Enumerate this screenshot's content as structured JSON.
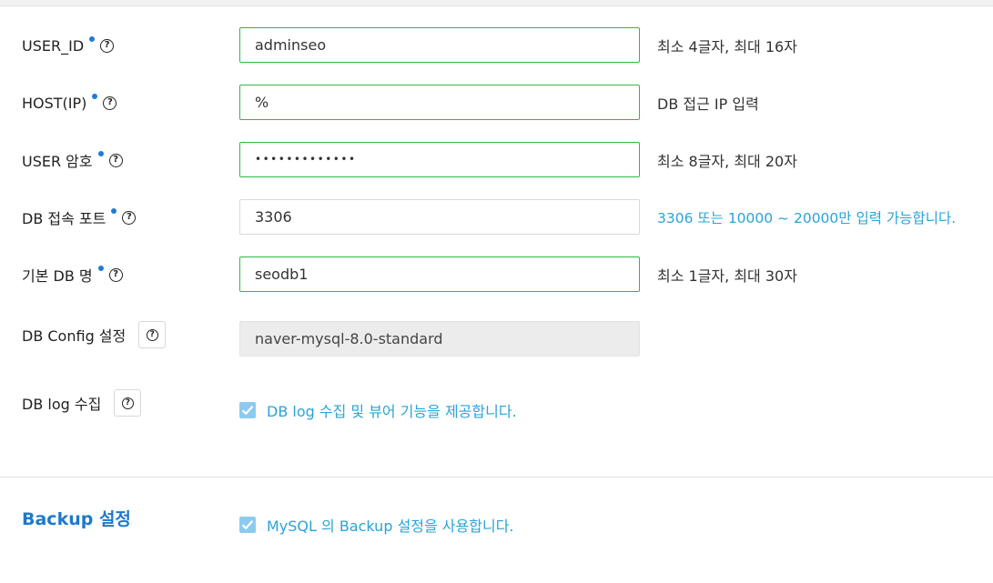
{
  "fields": [
    {
      "label": "USER_ID",
      "value": "adminseo",
      "hint": "최소 4글자, 최대 16자"
    },
    {
      "label": "HOST(IP)",
      "value": "%",
      "hint": "DB 접근 IP 입력"
    },
    {
      "label": "USER 암호",
      "value": "•••••••••••••",
      "hint": "최소 8글자, 최대 20자"
    },
    {
      "label": "DB 접속 포트",
      "value": "3306",
      "hint": "3306 또는 10000 ~ 20000만 입력 가능합니다."
    },
    {
      "label": "기본 DB 명",
      "value": "seodb1",
      "hint": "최소 1글자, 최대 30자"
    }
  ],
  "db_config": {
    "label": "DB Config 설정",
    "value": "naver-mysql-8.0-standard"
  },
  "db_log": {
    "label": "DB log 수집",
    "checkbox_label": "DB log 수집 및 뷰어 기능을 제공합니다.",
    "checked": true
  },
  "backup": {
    "title": "Backup 설정",
    "checkbox_label": "MySQL 의 Backup 설정을 사용합니다.",
    "checked": true
  },
  "help_glyph": "?",
  "colors": {
    "accent": "#1f78c9",
    "hint_blue": "#2aa3d6",
    "input_border": "#2fb84a",
    "checkbox": "#8dcaf0"
  },
  "icons": [
    "required-dot",
    "help-icon",
    "checkbox-checked-icon"
  ]
}
